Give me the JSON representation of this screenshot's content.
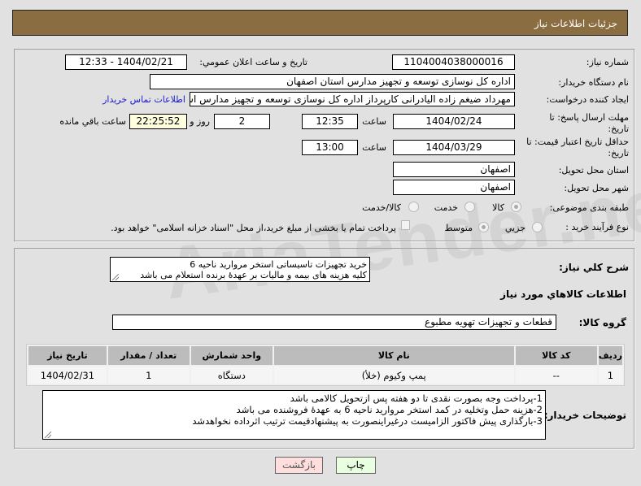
{
  "header": {
    "title": "جزئیات اطلاعات نیاز"
  },
  "form": {
    "need_number_label": "شماره نیاز:",
    "need_number": "1104004038000016",
    "announce_label": "تاریخ و ساعت اعلان عمومي:",
    "announce_value": "1404/02/21 - 12:33",
    "buyer_org_label": "نام دستگاه خریدار:",
    "buyer_org": "اداره کل نوسازی  توسعه و تجهیز مدارس استان اصفهان",
    "creator_label": "ایجاد کننده درخواست:",
    "creator": "مهرداد ضیغم زاده الیادرانی کارپرداز اداره کل نوسازی  توسعه و تجهیز مدارس اس",
    "contact_link": "اطلاعات تماس خریدار",
    "deadline_label": "مهلت ارسال پاسخ: تا تاریخ:",
    "deadline_date": "1404/02/24",
    "time_label": "ساعت",
    "deadline_time": "12:35",
    "days": "2",
    "days_label": "روز و",
    "remaining": "22:25:52",
    "remaining_label": "ساعت باقي مانده",
    "validity_label": "حداقل تاریخ اعتبار قیمت: تا تاریخ:",
    "validity_date": "1404/03/29",
    "validity_time": "13:00",
    "province_label": "استان محل تحویل:",
    "province": "اصفهان",
    "city_label": "شهر محل تحویل:",
    "city": "اصفهان",
    "category_label": "طبقه بندی موضوعی:",
    "category_options": [
      "کالا",
      "خدمت",
      "کالا/خدمت"
    ],
    "category_selected": "کالا",
    "process_label": "نوع فرآیند خرید :",
    "process_options": [
      "جزیي",
      "متوسط"
    ],
    "process_selected": "متوسط",
    "payment_note": "پرداخت تمام یا بخشی از مبلغ خرید،از محل \"اسناد خزانه اسلامی\" خواهد بود."
  },
  "details": {
    "description_label": "شرح کلي نیاز:",
    "description": "خرید تجهیزات تاسیساتی استخر مروارید ناحیه 6\nکلیه هزینه های بیمه و مالیات بر عهدۀ برنده استعلام می باشد",
    "goods_title": "اطلاعات کالاهاي مورد نیاز",
    "group_label": "گروه کالا:",
    "group": "قطعات و تجهیزات تهویه مطبوع",
    "table": {
      "headers": [
        "ردیف",
        "کد کالا",
        "نام کالا",
        "واحد شمارش",
        "تعداد / مقدار",
        "تاریخ نیاز"
      ],
      "rows": [
        [
          "1",
          "--",
          "پمپ وکیوم (خلأ)",
          "دستگاه",
          "1",
          "1404/02/31"
        ]
      ]
    },
    "notes_label": "توضیحات خریدار:",
    "notes": "1-پرداخت وجه بصورت نقدی تا دو هفته پس ازتحویل کالامی باشد\n2-هزینه حمل وتخلیه در کمد استخر مروارید ناحیه 6 به عهدۀ فروشنده می باشد\n3-بارگذاری پیش فاکتور الزامیست درغیراینصورت به پیشنهادقیمت ترتیب اثرداده نخواهدشد"
  },
  "buttons": {
    "print": "چاپ",
    "back": "بازگشت"
  },
  "watermark": "AriaTender.neT",
  "colors": {
    "header": "#8b6d42",
    "back_button": "#ffdede",
    "print_button": "#e8ffe0",
    "link": "#1a1ad0"
  }
}
